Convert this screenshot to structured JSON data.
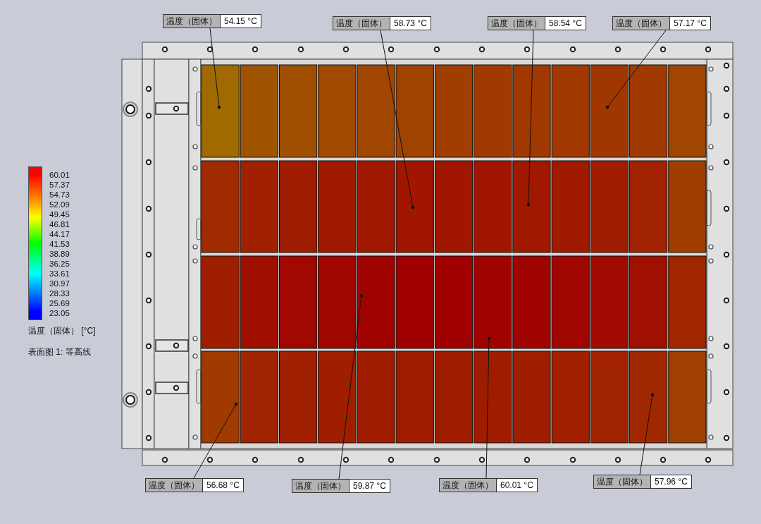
{
  "legend": {
    "ticks": [
      "60.01",
      "57.37",
      "54.73",
      "52.09",
      "49.45",
      "46.81",
      "44.17",
      "41.53",
      "38.89",
      "36.25",
      "33.61",
      "30.97",
      "28.33",
      "25.69",
      "23.05"
    ],
    "quantity": "温度（固体） [°C]",
    "plot_name": "表面图 1: 等高线"
  },
  "model": {
    "cell_rows": [
      {
        "cells": [
          {
            "color": "#a06a00"
          },
          {
            "color": "#a05400"
          },
          {
            "color": "#a04e00"
          },
          {
            "color": "#a04a00"
          },
          {
            "color": "#a04600"
          },
          {
            "color": "#a04200"
          },
          {
            "color": "#a03e00"
          },
          {
            "color": "#a03a00"
          },
          {
            "color": "#a03800"
          },
          {
            "color": "#a03800"
          },
          {
            "color": "#a03600"
          },
          {
            "color": "#a03a00"
          },
          {
            "color": "#a04600"
          }
        ]
      },
      {
        "cells": [
          {
            "color": "#a02a00"
          },
          {
            "color": "#a02000"
          },
          {
            "color": "#a01c00"
          },
          {
            "color": "#a01a00"
          },
          {
            "color": "#a01800"
          },
          {
            "color": "#a01600"
          },
          {
            "color": "#a01600"
          },
          {
            "color": "#a01600"
          },
          {
            "color": "#a01800"
          },
          {
            "color": "#a01a00"
          },
          {
            "color": "#a01c00"
          },
          {
            "color": "#a02200"
          },
          {
            "color": "#a03e00"
          }
        ]
      },
      {
        "cells": [
          {
            "color": "#a01e00"
          },
          {
            "color": "#a00e00"
          },
          {
            "color": "#a00800"
          },
          {
            "color": "#a00600"
          },
          {
            "color": "#a00200"
          },
          {
            "color": "#a00000"
          },
          {
            "color": "#a00000"
          },
          {
            "color": "#a00200"
          },
          {
            "color": "#a00400"
          },
          {
            "color": "#a00600"
          },
          {
            "color": "#a00a00"
          },
          {
            "color": "#a01000"
          },
          {
            "color": "#a02600"
          }
        ]
      },
      {
        "cells": [
          {
            "color": "#a03a00"
          },
          {
            "color": "#a02400"
          },
          {
            "color": "#a02000"
          },
          {
            "color": "#a01e00"
          },
          {
            "color": "#a01c00"
          },
          {
            "color": "#a01c00"
          },
          {
            "color": "#a01c00"
          },
          {
            "color": "#a01c00"
          },
          {
            "color": "#a01e00"
          },
          {
            "color": "#a02000"
          },
          {
            "color": "#a02200"
          },
          {
            "color": "#a02800"
          },
          {
            "color": "#a04000"
          }
        ]
      }
    ]
  },
  "probes": [
    {
      "label": "温度（固体）",
      "value": "54.15 °C"
    },
    {
      "label": "温度（固体）",
      "value": "58.73 °C"
    },
    {
      "label": "温度（固体）",
      "value": "58.54 °C"
    },
    {
      "label": "温度（固体）",
      "value": "57.17 °C"
    },
    {
      "label": "温度（固体）",
      "value": "56.68 °C"
    },
    {
      "label": "温度（固体）",
      "value": "59.87 °C"
    },
    {
      "label": "温度（固体）",
      "value": "60.01 °C"
    },
    {
      "label": "温度（固体）",
      "value": "57.96 °C"
    }
  ]
}
